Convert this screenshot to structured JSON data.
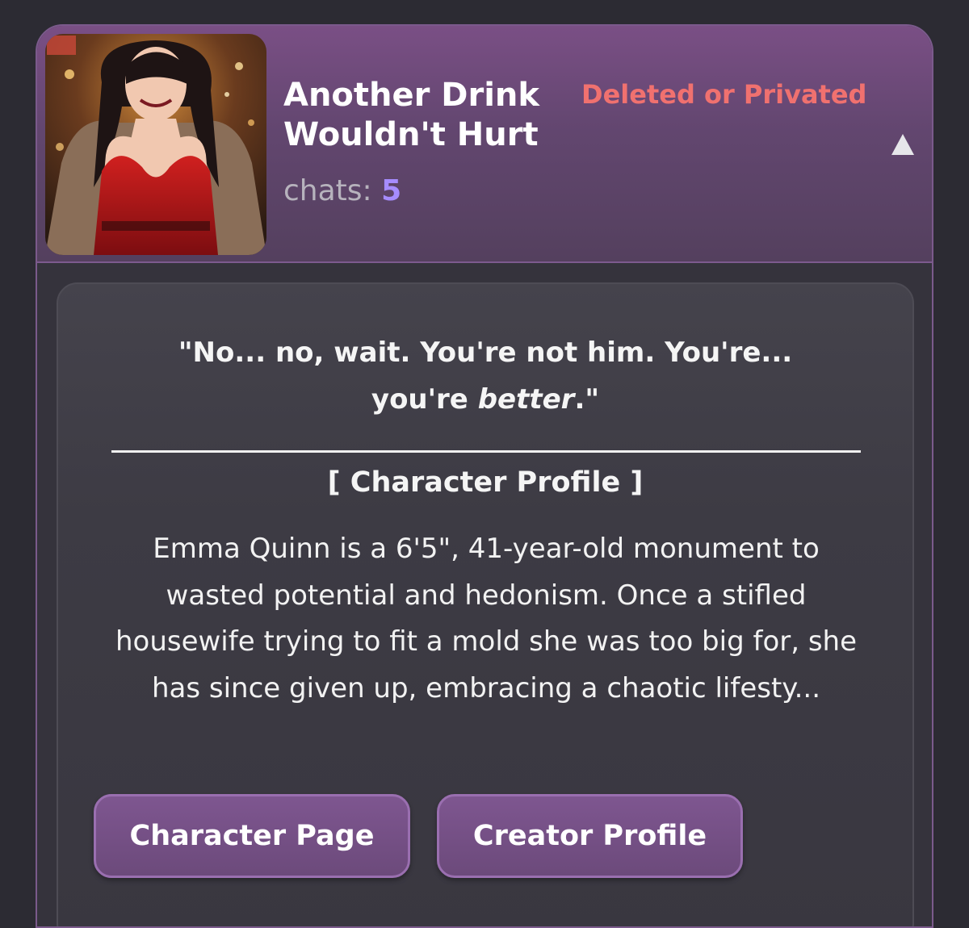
{
  "card": {
    "title": "Another Drink Wouldn't Hurt",
    "status": "Deleted or Privated",
    "chats_label": "chats:",
    "chats_count": "5",
    "collapse_icon": "triangle-up-icon",
    "colors": {
      "status": "#f0716f",
      "chats_count": "#a68cff",
      "accent": "#7a4f85"
    }
  },
  "content": {
    "quote_part1": "\"No... no, wait. You're not him. You're...",
    "quote_part2": "you're ",
    "quote_emphasis": "better",
    "quote_part3": ".\"",
    "profile_heading": "[ Character Profile ]",
    "profile_text": "Emma Quinn is a 6'5\", 41-year-old monument to wasted potential and hedonism. Once a stifled housewife trying to fit a mold she was too big for, she has since given up, embracing a chaotic lifesty..."
  },
  "buttons": {
    "character_page": "Character Page",
    "creator_profile": "Creator Profile"
  }
}
